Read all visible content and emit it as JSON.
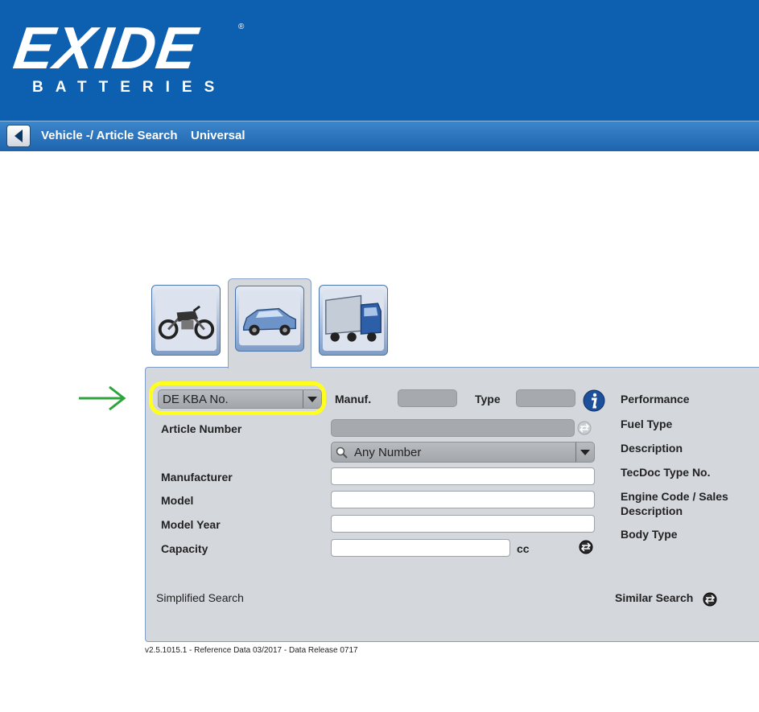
{
  "brand": {
    "logo_text": "EXIDE",
    "logo_subtext": "BATTERIES",
    "registered": "®"
  },
  "colors": {
    "header": "#0d5fb0",
    "navbar": "#2b73bb",
    "panel": "#d4d7dc",
    "highlight": "#ffff1e",
    "arrow": "#2da43c"
  },
  "navbar": {
    "back_icon": "back-arrow-icon",
    "crumb_search": "Vehicle -/ Article Search",
    "crumb_universal": "Universal"
  },
  "tabs": [
    {
      "name": "motorcycle",
      "icon": "motorcycle-icon",
      "active": false
    },
    {
      "name": "car",
      "icon": "car-icon",
      "active": true
    },
    {
      "name": "truck",
      "icon": "truck-icon",
      "active": false
    }
  ],
  "form": {
    "search_type_value": "DE KBA No.",
    "manuf_label": "Manuf.",
    "type_label": "Type",
    "article_number_label": "Article Number",
    "number_type_value": "Any Number",
    "manufacturer_label": "Manufacturer",
    "model_label": "Model",
    "model_year_label": "Model Year",
    "capacity_label": "Capacity",
    "capacity_unit": "cc",
    "simplified_search": "Simplified Search",
    "similar_search": "Similar Search"
  },
  "details": {
    "performance": "Performance",
    "fuel_type": "Fuel Type",
    "description": "Description",
    "tecdoc_type_no": "TecDoc Type No.",
    "engine_code_line1": "Engine Code / Sales",
    "engine_code_line2": "Description",
    "body_type": "Body Type"
  },
  "footer": {
    "version": "v2.5.1015.1 - Reference Data 03/2017 - Data Release 0717"
  }
}
